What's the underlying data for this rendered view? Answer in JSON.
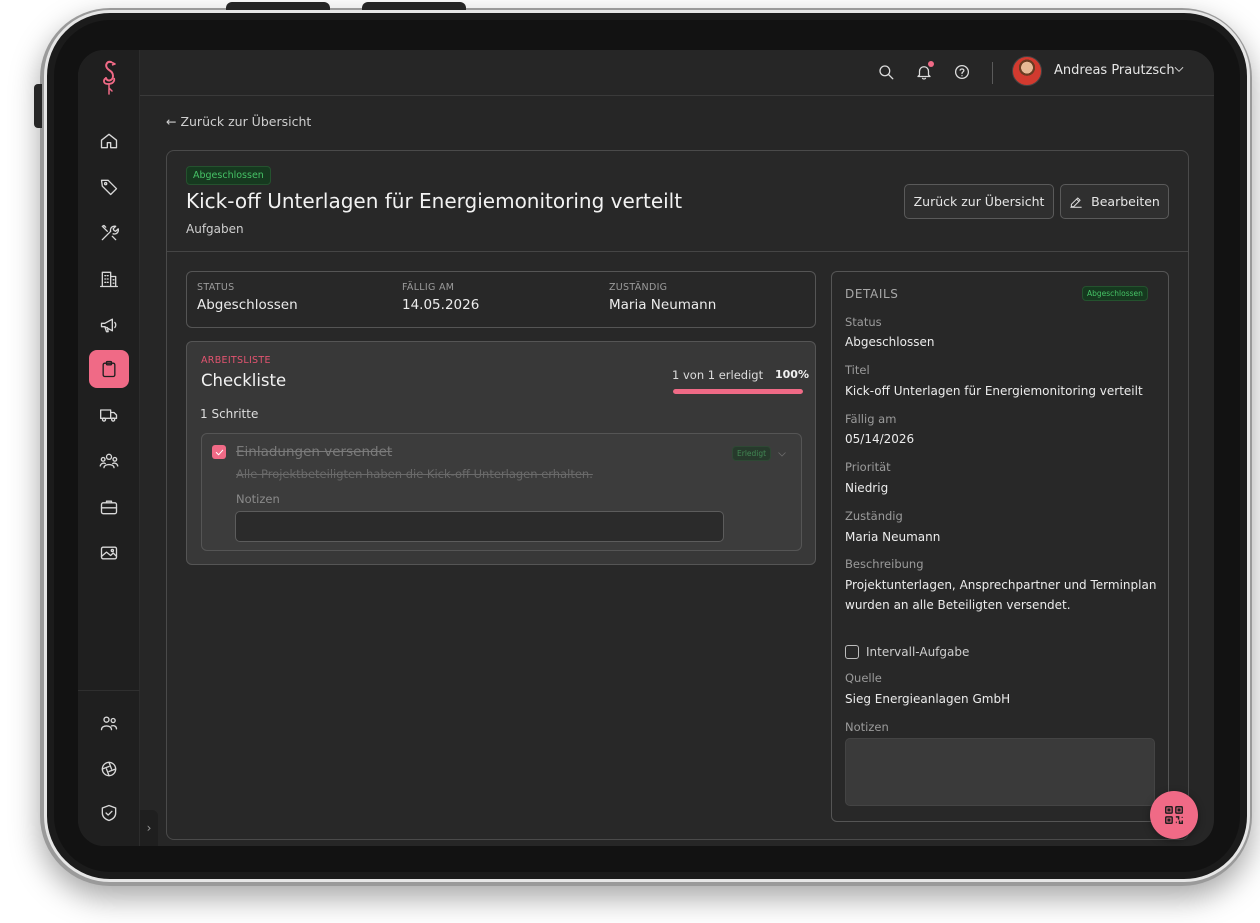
{
  "topbar": {
    "user_name": "Andreas Prautzsch"
  },
  "sidebar": {
    "items": [
      {
        "id": "home",
        "icon": "home-icon"
      },
      {
        "id": "tags",
        "icon": "tag-icon"
      },
      {
        "id": "tools",
        "icon": "tools-icon"
      },
      {
        "id": "buildings",
        "icon": "building-icon"
      },
      {
        "id": "campaigns",
        "icon": "megaphone-icon"
      },
      {
        "id": "tasks",
        "icon": "clipboard-icon",
        "active": true
      },
      {
        "id": "vehicles",
        "icon": "truck-icon"
      },
      {
        "id": "contacts",
        "icon": "people-icon"
      },
      {
        "id": "jobs",
        "icon": "briefcase-icon"
      },
      {
        "id": "media",
        "icon": "image-icon"
      },
      {
        "id": "users",
        "icon": "users-icon"
      },
      {
        "id": "integrations",
        "icon": "aperture-icon"
      },
      {
        "id": "security",
        "icon": "shield-check-icon"
      }
    ],
    "collapse_label": "›"
  },
  "page": {
    "back_link": "← Zurück zur Übersicht",
    "status_badge": "Abgeschlossen",
    "title": "Kick-off Unterlagen für Energiemonitoring verteilt",
    "subtitle": "Aufgaben",
    "back_button": "Zurück zur Übersicht",
    "edit_button": "Bearbeiten"
  },
  "info": {
    "status_label": "STATUS",
    "status_value": "Abgeschlossen",
    "due_label": "FÄLLIG AM",
    "due_value": "14.05.2026",
    "assignee_label": "ZUSTÄNDIG",
    "assignee_value": "Maria Neumann"
  },
  "checklist": {
    "kicker": "ARBEITSLISTE",
    "title": "Checkliste",
    "steps": "1 Schritte",
    "progress_text": "1 von 1 erledigt",
    "progress_pct": "100%",
    "progress_fraction": 1.0,
    "item": {
      "title": "Einladungen versendet",
      "description": "Alle Projektbeteiligten haben die Kick-off Unterlagen erhalten.",
      "badge": "Erledigt",
      "notes_label": "Notizen",
      "notes_value": ""
    }
  },
  "details": {
    "kicker": "DETAILS",
    "badge": "Abgeschlossen",
    "status_label": "Status",
    "status_value": "Abgeschlossen",
    "title_label": "Titel",
    "title_value": "Kick-off Unterlagen für Energiemonitoring verteilt",
    "due_label": "Fällig am",
    "due_value": "05/14/2026",
    "priority_label": "Priorität",
    "priority_value": "Niedrig",
    "assignee_label": "Zuständig",
    "assignee_value": "Maria Neumann",
    "description_label": "Beschreibung",
    "description_value": "Projektunterlagen, Ansprechpartner und Terminplan wurden an alle Beteiligten versendet.",
    "interval_label": "Intervall-Aufgabe",
    "interval_checked": false,
    "source_label": "Quelle",
    "source_value": "Sieg Energieanlagen GmbH",
    "notes_label": "Notizen",
    "notes_value": ""
  },
  "colors": {
    "accent": "#f06a86",
    "success": "#46c266",
    "background": "#262626"
  }
}
